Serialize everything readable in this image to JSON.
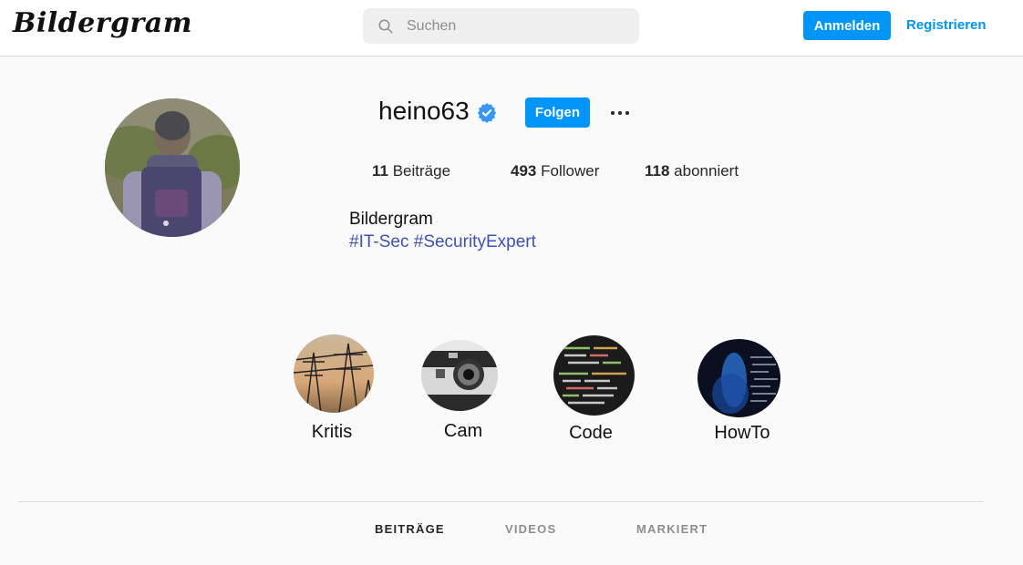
{
  "header": {
    "logo": "Bildergram",
    "search_placeholder": "Suchen",
    "login_label": "Anmelden",
    "register_label": "Registrieren"
  },
  "profile": {
    "username": "heino63",
    "verified": true,
    "follow_label": "Folgen",
    "stats": [
      {
        "count": "11",
        "label": "Beiträge"
      },
      {
        "count": "493",
        "label": "Follower"
      },
      {
        "count": "118",
        "label": "abonniert"
      }
    ],
    "bio_name": "Bildergram",
    "bio_tags": "#IT-Sec #SecurityExpert"
  },
  "highlights": [
    {
      "label": "Kritis",
      "icon": "power-pylon-image"
    },
    {
      "label": "Cam",
      "icon": "camera-image"
    },
    {
      "label": "Code",
      "icon": "code-screen-image"
    },
    {
      "label": "HowTo",
      "icon": "keyboard-light-image"
    }
  ],
  "tabs": [
    {
      "label": "BEITRÄGE",
      "active": true
    },
    {
      "label": "VIDEOS",
      "active": false
    },
    {
      "label": "MARKIERT",
      "active": false
    }
  ],
  "colors": {
    "accent": "#0095f6",
    "hashtag": "#3f51b5",
    "background": "#fafafa"
  }
}
